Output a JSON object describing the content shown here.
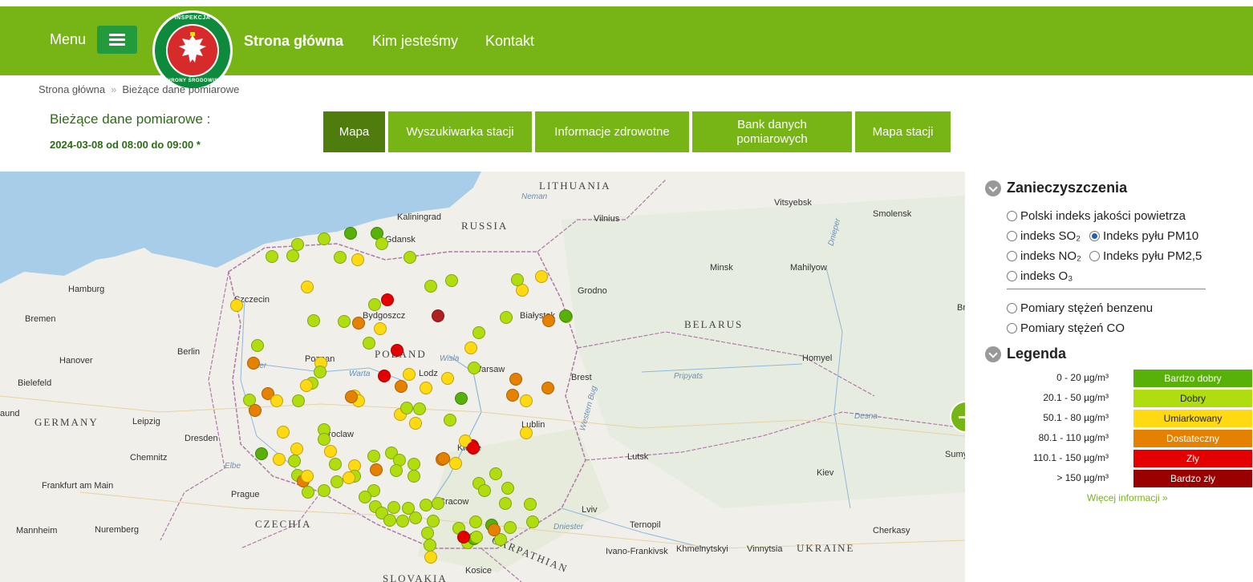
{
  "header": {
    "menu_label": "Menu",
    "logo_top_text": "INSPEKCJA",
    "logo_bottom_text": "OCHRONY ŚRODOWISKA",
    "nav": [
      {
        "label": "Strona główna",
        "bold": true
      },
      {
        "label": "Kim jesteśmy",
        "bold": false
      },
      {
        "label": "Kontakt",
        "bold": false
      }
    ]
  },
  "breadcrumb": {
    "items": [
      "Strona główna",
      "Bieżące dane pomiarowe"
    ],
    "separator": "»"
  },
  "page": {
    "title": "Bieżące dane pomiarowe :",
    "date": "2024-03-08 od 08:00 do 09:00 *"
  },
  "tabs": [
    {
      "label": "Mapa",
      "active": true
    },
    {
      "label": "Wyszukiwarka stacji",
      "active": false
    },
    {
      "label": "Informacje zdrowotne",
      "active": false
    },
    {
      "label": "Bank danych pomiarowych",
      "active": false
    },
    {
      "label": "Mapa stacji",
      "active": false
    }
  ],
  "map": {
    "labels": [
      {
        "text": "LITHUANIA",
        "kind": "country"
      },
      {
        "text": "RUSSIA",
        "kind": "country"
      },
      {
        "text": "BELARUS",
        "kind": "country"
      },
      {
        "text": "POLAND",
        "kind": "country"
      },
      {
        "text": "GERMANY",
        "kind": "country"
      },
      {
        "text": "CZECHIA",
        "kind": "country"
      },
      {
        "text": "UKRAINE",
        "kind": "country"
      },
      {
        "text": "SLOVAKIA",
        "kind": "country"
      },
      {
        "text": "Kaliningrad",
        "kind": "city"
      },
      {
        "text": "Vilnius",
        "kind": "city"
      },
      {
        "text": "Vitsyebsk",
        "kind": "city"
      },
      {
        "text": "Smolensk",
        "kind": "city"
      },
      {
        "text": "Gdansk",
        "kind": "city"
      },
      {
        "text": "Hamburg",
        "kind": "city"
      },
      {
        "text": "Szczecin",
        "kind": "city"
      },
      {
        "text": "Bremen",
        "kind": "city"
      },
      {
        "text": "Bydgoszcz",
        "kind": "city"
      },
      {
        "text": "Białystok",
        "kind": "city"
      },
      {
        "text": "Grodno",
        "kind": "city"
      },
      {
        "text": "Minsk",
        "kind": "city"
      },
      {
        "text": "Mahilyow",
        "kind": "city"
      },
      {
        "text": "Berlin",
        "kind": "city"
      },
      {
        "text": "Hanover",
        "kind": "city"
      },
      {
        "text": "Poznan",
        "kind": "city"
      },
      {
        "text": "Warsaw",
        "kind": "city"
      },
      {
        "text": "Homyel",
        "kind": "city"
      },
      {
        "text": "Bielefeld",
        "kind": "city"
      },
      {
        "text": "Lodz",
        "kind": "city"
      },
      {
        "text": "Brest",
        "kind": "city"
      },
      {
        "text": "Leipzig",
        "kind": "city"
      },
      {
        "text": "Dresden",
        "kind": "city"
      },
      {
        "text": "Wroclaw",
        "kind": "city"
      },
      {
        "text": "Lublin",
        "kind": "city"
      },
      {
        "text": "Kielce",
        "kind": "city"
      },
      {
        "text": "Chemnitz",
        "kind": "city"
      },
      {
        "text": "Lutsk",
        "kind": "city"
      },
      {
        "text": "Kiev",
        "kind": "city"
      },
      {
        "text": "Frankfurt am Main",
        "kind": "city"
      },
      {
        "text": "Prague",
        "kind": "city"
      },
      {
        "text": "Cracow",
        "kind": "city"
      },
      {
        "text": "Lviv",
        "kind": "city"
      },
      {
        "text": "Mannheim",
        "kind": "city"
      },
      {
        "text": "Nuremberg",
        "kind": "city"
      },
      {
        "text": "Ternopil",
        "kind": "city"
      },
      {
        "text": "Cherkasy",
        "kind": "city"
      },
      {
        "text": "Ivano-Frankivsk",
        "kind": "city"
      },
      {
        "text": "Khmelnytskyi",
        "kind": "city"
      },
      {
        "text": "Vinnytsia",
        "kind": "city"
      },
      {
        "text": "Kosice",
        "kind": "city"
      },
      {
        "text": "CARPATHIAN",
        "kind": "country"
      },
      {
        "text": "Neman",
        "kind": "water"
      },
      {
        "text": "Wisla",
        "kind": "water"
      },
      {
        "text": "Warta",
        "kind": "water"
      },
      {
        "text": "Oder",
        "kind": "water"
      },
      {
        "text": "Elbe",
        "kind": "water"
      },
      {
        "text": "Pripyats",
        "kind": "water"
      },
      {
        "text": "Dniester",
        "kind": "water"
      },
      {
        "text": "Desna",
        "kind": "water"
      },
      {
        "text": "Western Bug",
        "kind": "water"
      },
      {
        "text": "Dnieper",
        "kind": "water"
      },
      {
        "text": "Sumy",
        "kind": "city"
      },
      {
        "text": "aund",
        "kind": "city"
      },
      {
        "text": "Br",
        "kind": "city"
      }
    ],
    "stations": [
      "dobry",
      "dobry",
      "bardzo_dobry",
      "bardzo_dobry",
      "dobry",
      "dobry",
      "dobry",
      "dobry",
      "umiarkowany",
      "dobry",
      "umiarkowany",
      "dobry",
      "dobry",
      "umiarkowany",
      "dobry",
      "zly",
      "umiarkowany",
      "bardzo_zly",
      "dobry",
      "dobry",
      "dobry",
      "umiarkowany",
      "dostateczny",
      "dobry",
      "dobry",
      "umiarkowany",
      "dostateczny",
      "bardzo_dobry",
      "dobry",
      "dobry",
      "dobry",
      "zly",
      "umiarkowany",
      "umiarkowany",
      "dostateczny",
      "umiarkowany",
      "dobry",
      "dobry",
      "umiarkowany",
      "zly",
      "umiarkowany",
      "dostateczny",
      "umiarkowany",
      "dobry",
      "dostateczny",
      "umiarkowany",
      "dostateczny",
      "umiarkowany",
      "bardzo_dobry",
      "dobry",
      "dostateczny",
      "umiarkowany",
      "dobry",
      "dostateczny",
      "umiarkowany",
      "dostateczny",
      "dobry",
      "umiarkowany",
      "dobry",
      "umiarkowany",
      "dobry",
      "dostateczny",
      "umiarkowany",
      "dobry",
      "umiarkowany",
      "dobry",
      "umiarkowany",
      "dostateczny",
      "zly",
      "umiarkowany",
      "dobry",
      "umiarkowany",
      "zly",
      "dostateczny",
      "bardzo_dobry",
      "umiarkowany",
      "dobry",
      "dobry",
      "dostateczny",
      "umiarkowany",
      "dobry",
      "umiarkowany",
      "dobry",
      "dobry",
      "dobry",
      "umiarkowany",
      "dobry",
      "dobry",
      "dobry",
      "dobry",
      "dostateczny",
      "dobry",
      "dobry",
      "dobry",
      "umiarkowany",
      "dobry",
      "dobry",
      "dobry",
      "dobry",
      "dobry",
      "dobry",
      "dobry",
      "dobry",
      "dobry",
      "dobry",
      "dobry",
      "dobry",
      "dobry",
      "dobry",
      "dobry",
      "dobry",
      "dobry",
      "dobry",
      "dobry",
      "bardzo_dobry",
      "dobry",
      "dobry",
      "dobry",
      "dobry",
      "dobry",
      "bardzo_dobry",
      "dobry",
      "zly",
      "dostateczny",
      "umiarkowany",
      "dobry"
    ]
  },
  "pollutants": {
    "heading": "Zanieczyszczenia",
    "options": [
      {
        "label": "Polski indeks jakości powietrza",
        "selected": false
      },
      {
        "label": "indeks SO₂",
        "selected": false
      },
      {
        "label": "Indeks pyłu PM10",
        "selected": true
      },
      {
        "label": "indeks NO₂",
        "selected": false
      },
      {
        "label": "Indeks pyłu PM2,5",
        "selected": false
      },
      {
        "label": "indeks O₃",
        "selected": false
      },
      {
        "label": "Pomiary stężeń benzenu",
        "selected": false
      },
      {
        "label": "Pomiary stężeń CO",
        "selected": false
      }
    ]
  },
  "legend": {
    "heading": "Legenda",
    "rows": [
      {
        "range": "0 - 20 µg/m³",
        "label": "Bardzo dobry",
        "color": "#57b108",
        "text_color": "#ffffff"
      },
      {
        "range": "20.1 - 50 µg/m³",
        "label": "Dobry",
        "color": "#b0dd10",
        "text_color": "#222222"
      },
      {
        "range": "50.1 - 80 µg/m³",
        "label": "Umiarkowany",
        "color": "#ffd911",
        "text_color": "#222222"
      },
      {
        "range": "80.1 - 110 µg/m³",
        "label": "Dostateczny",
        "color": "#e58100",
        "text_color": "#ffffff"
      },
      {
        "range": "110.1 - 150 µg/m³",
        "label": "Zły",
        "color": "#e50000",
        "text_color": "#ffffff"
      },
      {
        "range": "> 150 µg/m³",
        "label": "Bardzo zły",
        "color": "#990000",
        "text_color": "#ffffff"
      }
    ],
    "more_link": "Więcej informacji »"
  },
  "colors": {
    "brand_green": "#76b515",
    "dark_green": "#239a3b",
    "active_tab": "#4e7d0e",
    "stations": {
      "bardzo_dobry": "#57b108",
      "dobry": "#b0dd10",
      "umiarkowany": "#ffd911",
      "dostateczny": "#e58100",
      "zly": "#e50000",
      "bardzo_zly": "#b02020"
    }
  }
}
